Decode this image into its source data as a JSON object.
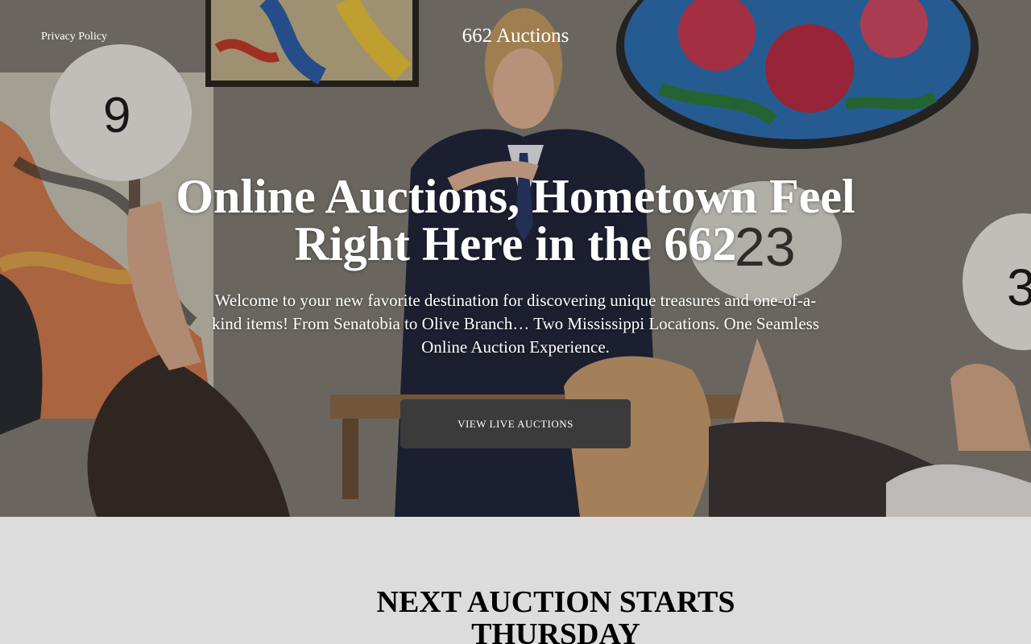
{
  "header": {
    "privacy_link": "Privacy Policy",
    "site_title": "662 Auctions"
  },
  "hero": {
    "headline": "Online Auctions, Hometown Feel Right Here in the 662",
    "subtext": "Welcome to your new favorite destination for discovering unique treasures and one-of-a-kind items! From Senatobia to Olive Branch… Two Mississippi Locations. One Seamless Online Auction Experience.",
    "cta_label": "VIEW LIVE AUCTIONS",
    "paddle_numbers": [
      "9",
      "23",
      "3"
    ]
  },
  "next_auction": {
    "heading": "NEXT AUCTION STARTS THURSDAY"
  },
  "colors": {
    "cta_background": "#3b3b3c",
    "section_background": "#dcdcdc",
    "text_light": "#ffffff"
  }
}
